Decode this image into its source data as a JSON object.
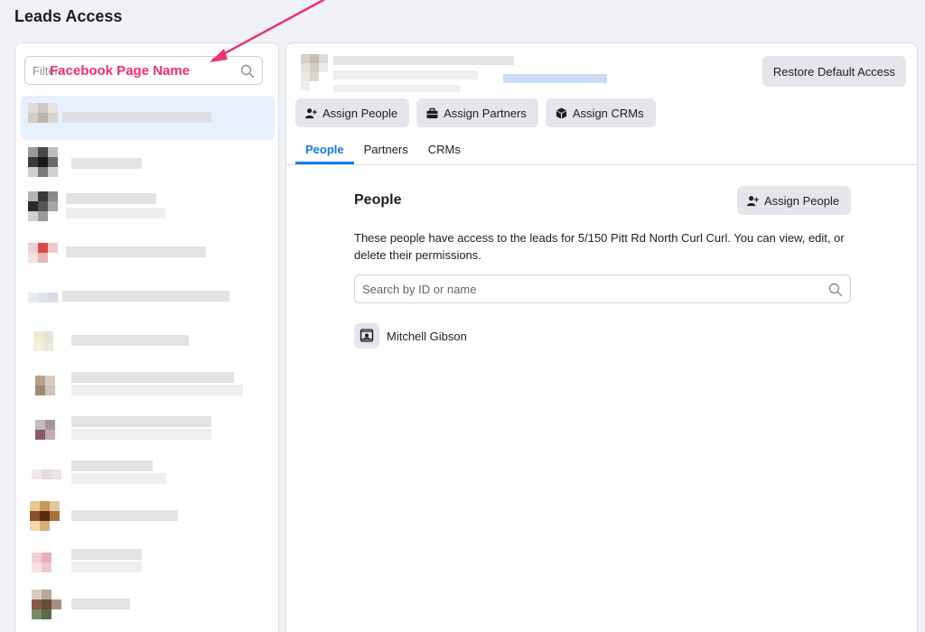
{
  "page": {
    "title": "Leads Access"
  },
  "filter": {
    "placeholder": "Filter"
  },
  "annotation": {
    "text": "Facebook Page Name",
    "color": "#f0306e"
  },
  "header": {
    "restore_label": "Restore Default Access",
    "actions": [
      {
        "label": "Assign People",
        "icon": "add-person-icon"
      },
      {
        "label": "Assign Partners",
        "icon": "briefcase-icon"
      },
      {
        "label": "Assign CRMs",
        "icon": "cube-icon"
      }
    ]
  },
  "tabs": [
    {
      "label": "People",
      "active": true
    },
    {
      "label": "Partners",
      "active": false
    },
    {
      "label": "CRMs",
      "active": false
    }
  ],
  "people_section": {
    "title": "People",
    "assign_label": "Assign People",
    "description": "These people have access to the leads for 5/150 Pitt Rd North Curl Curl. You can view, edit, or delete their permissions.",
    "search_placeholder": "Search by ID or name",
    "people": [
      {
        "name": "Mitchell Gibson",
        "icon": "person-card-icon"
      }
    ]
  },
  "colors": {
    "accent": "#1877f2",
    "page_bg": "#f0f2f5",
    "selected_bg": "#e7f0fd",
    "button_bg": "#e4e6eb"
  }
}
